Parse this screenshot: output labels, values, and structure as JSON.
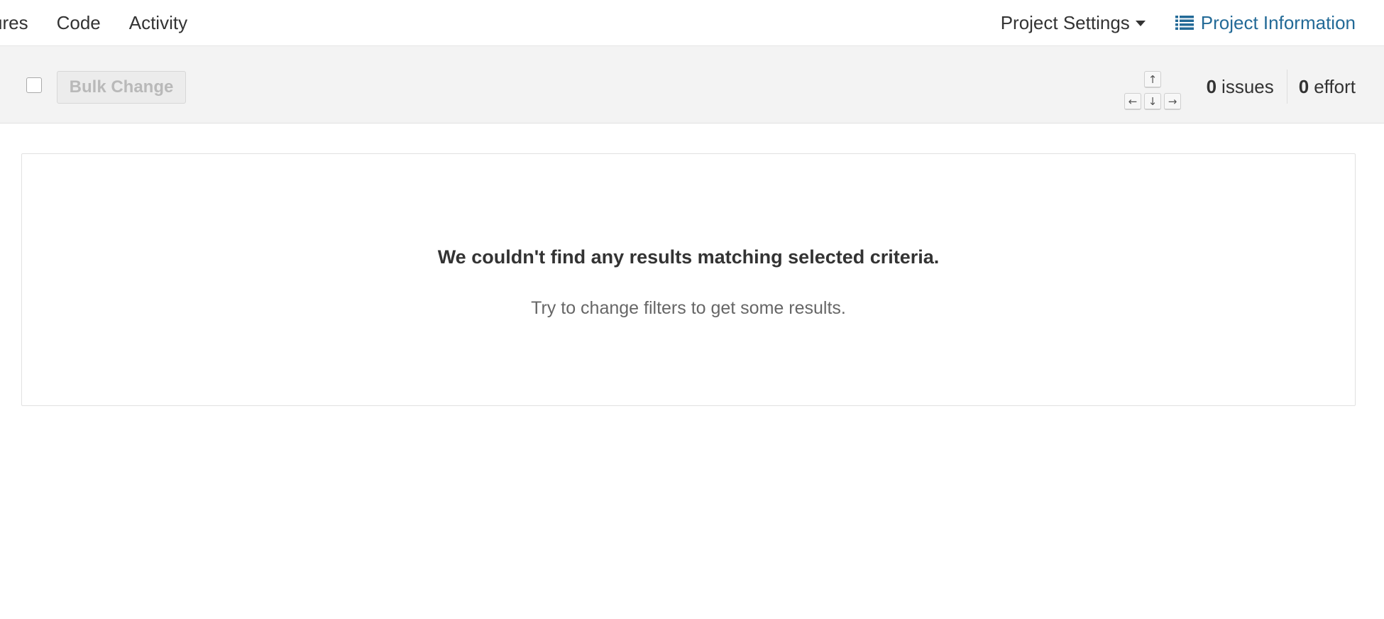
{
  "nav": {
    "items": [
      {
        "label": "sures"
      },
      {
        "label": "Code"
      },
      {
        "label": "Activity"
      }
    ],
    "settings_label": "Project Settings",
    "info_label": "Project Information"
  },
  "toolbar": {
    "bulk_change_label": "Bulk Change",
    "keys": {
      "up": "↑",
      "left": "←",
      "down": "↓",
      "right": "→"
    },
    "issues_count": "0",
    "issues_label": "issues",
    "effort_count": "0",
    "effort_label": "effort"
  },
  "empty_state": {
    "title": "We couldn't find any results matching selected criteria.",
    "subtitle": "Try to change filters to get some results."
  },
  "colors": {
    "link": "#236a97",
    "toolbar_bg": "#f3f3f3",
    "strip": "#fbe8c8"
  },
  "icons": {
    "settings_caret": "caret-down-icon",
    "info": "list-icon"
  }
}
